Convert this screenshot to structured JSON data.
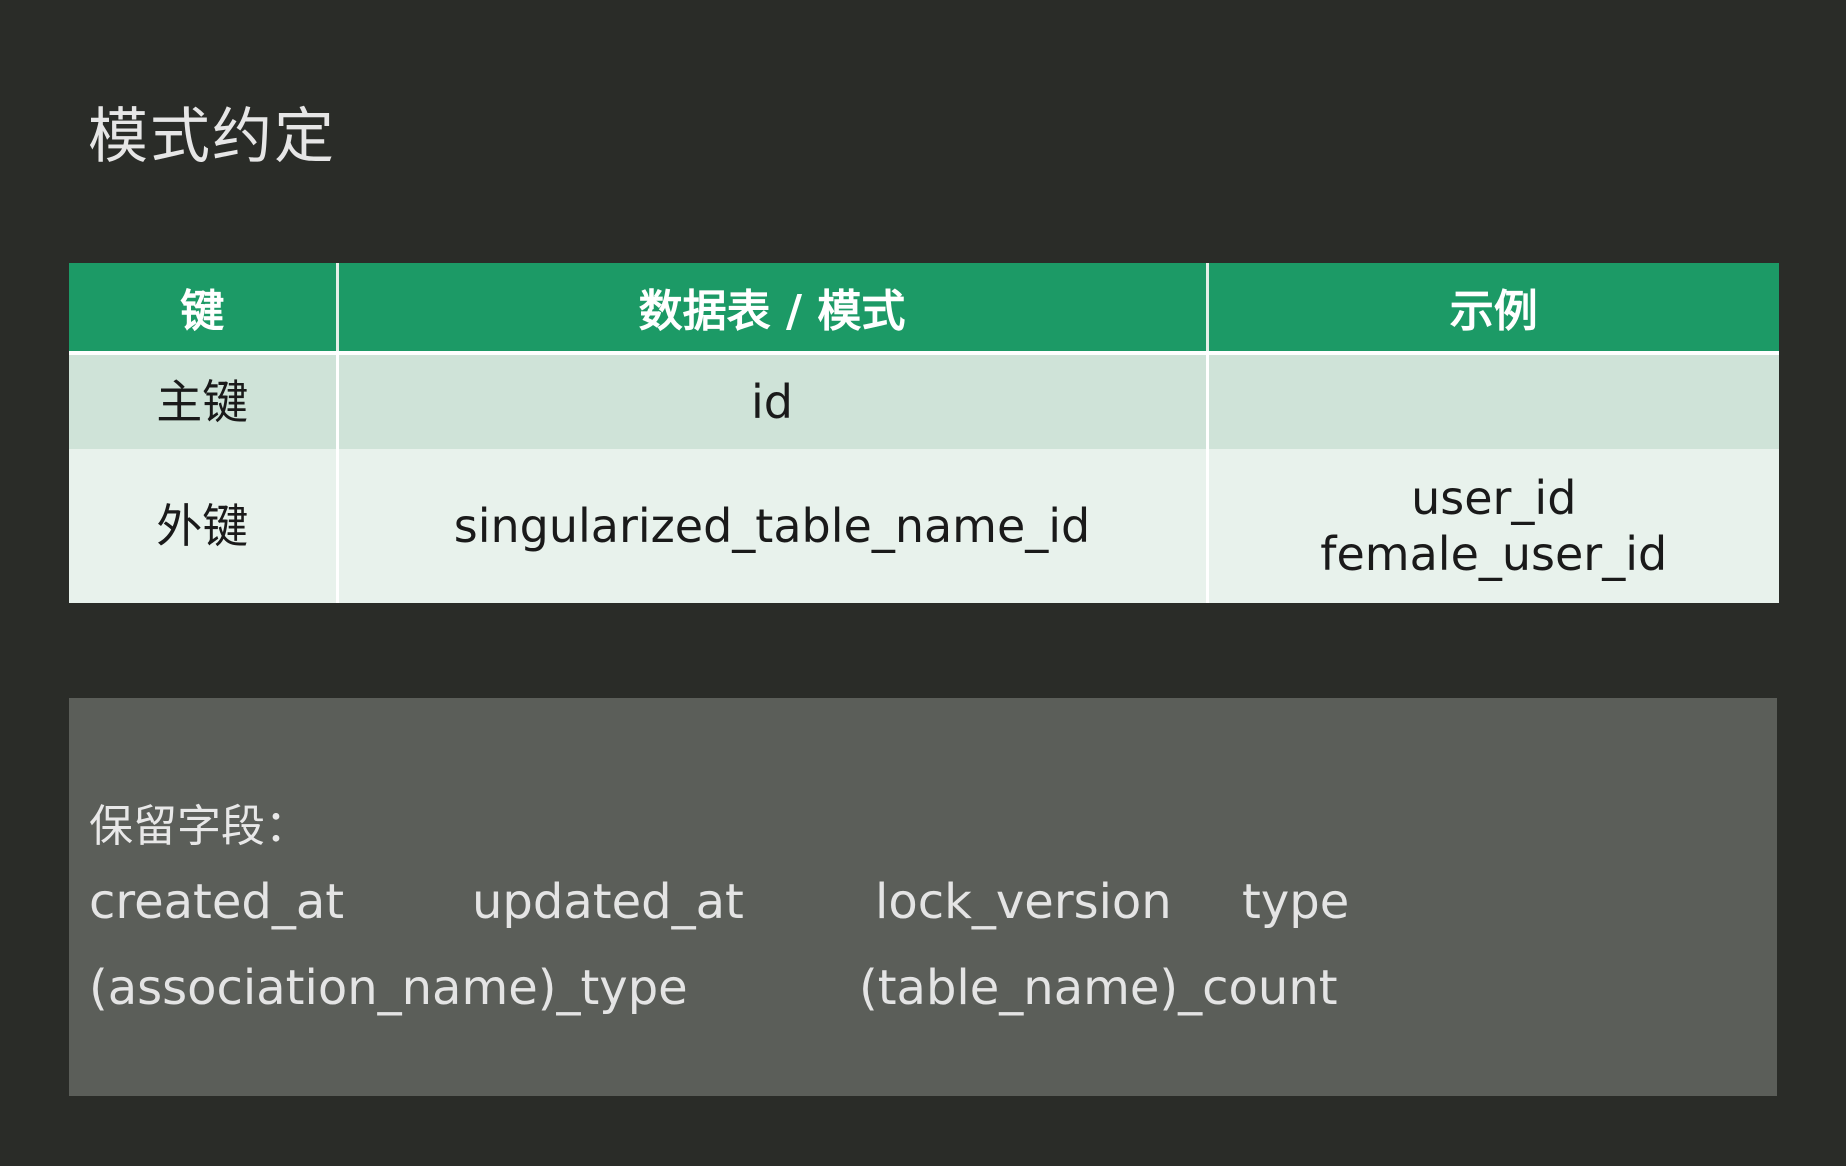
{
  "title": "模式约定",
  "table": {
    "headers": [
      "键",
      "数据表 / 模式",
      "示例"
    ],
    "rows": [
      {
        "key": "主键",
        "pattern": "id",
        "example": []
      },
      {
        "key": "外键",
        "pattern": "singularized_table_name_id",
        "example": [
          "user_id",
          "female_user_id"
        ]
      }
    ]
  },
  "reserved": {
    "heading": "保留字段：",
    "line1": [
      "created_at",
      "updated_at",
      "lock_version",
      "type"
    ],
    "line2": [
      "(association_name)_type",
      "(table_name)_count"
    ]
  }
}
